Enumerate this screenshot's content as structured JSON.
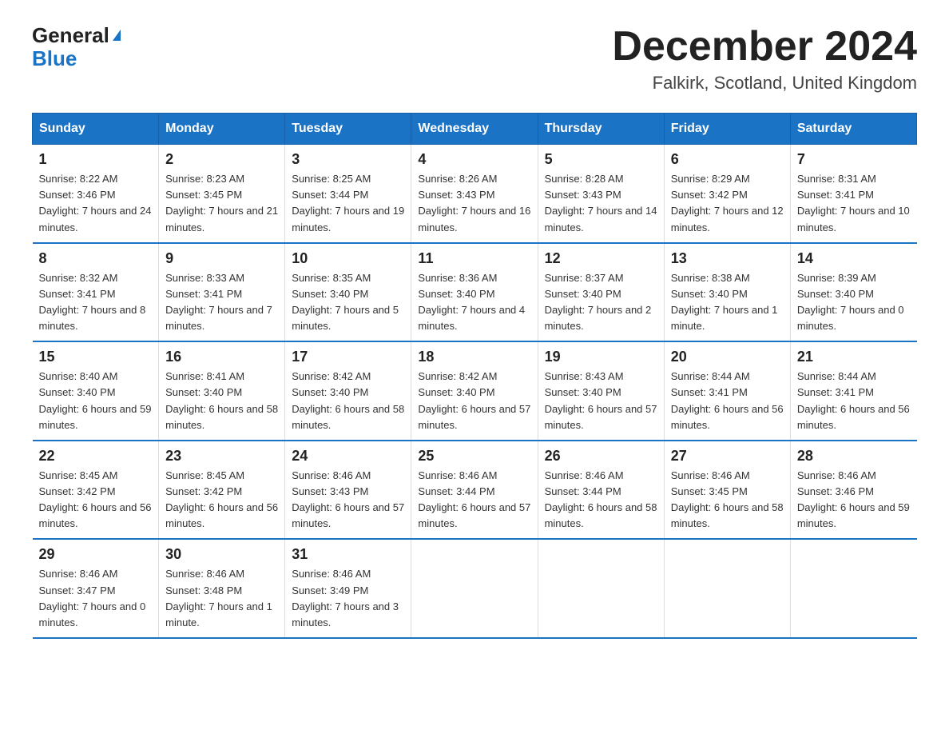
{
  "header": {
    "logo_general": "General",
    "logo_blue": "Blue",
    "title": "December 2024",
    "subtitle": "Falkirk, Scotland, United Kingdom"
  },
  "days_of_week": [
    "Sunday",
    "Monday",
    "Tuesday",
    "Wednesday",
    "Thursday",
    "Friday",
    "Saturday"
  ],
  "weeks": [
    [
      {
        "num": "1",
        "sunrise": "8:22 AM",
        "sunset": "3:46 PM",
        "daylight": "7 hours and 24 minutes."
      },
      {
        "num": "2",
        "sunrise": "8:23 AM",
        "sunset": "3:45 PM",
        "daylight": "7 hours and 21 minutes."
      },
      {
        "num": "3",
        "sunrise": "8:25 AM",
        "sunset": "3:44 PM",
        "daylight": "7 hours and 19 minutes."
      },
      {
        "num": "4",
        "sunrise": "8:26 AM",
        "sunset": "3:43 PM",
        "daylight": "7 hours and 16 minutes."
      },
      {
        "num": "5",
        "sunrise": "8:28 AM",
        "sunset": "3:43 PM",
        "daylight": "7 hours and 14 minutes."
      },
      {
        "num": "6",
        "sunrise": "8:29 AM",
        "sunset": "3:42 PM",
        "daylight": "7 hours and 12 minutes."
      },
      {
        "num": "7",
        "sunrise": "8:31 AM",
        "sunset": "3:41 PM",
        "daylight": "7 hours and 10 minutes."
      }
    ],
    [
      {
        "num": "8",
        "sunrise": "8:32 AM",
        "sunset": "3:41 PM",
        "daylight": "7 hours and 8 minutes."
      },
      {
        "num": "9",
        "sunrise": "8:33 AM",
        "sunset": "3:41 PM",
        "daylight": "7 hours and 7 minutes."
      },
      {
        "num": "10",
        "sunrise": "8:35 AM",
        "sunset": "3:40 PM",
        "daylight": "7 hours and 5 minutes."
      },
      {
        "num": "11",
        "sunrise": "8:36 AM",
        "sunset": "3:40 PM",
        "daylight": "7 hours and 4 minutes."
      },
      {
        "num": "12",
        "sunrise": "8:37 AM",
        "sunset": "3:40 PM",
        "daylight": "7 hours and 2 minutes."
      },
      {
        "num": "13",
        "sunrise": "8:38 AM",
        "sunset": "3:40 PM",
        "daylight": "7 hours and 1 minute."
      },
      {
        "num": "14",
        "sunrise": "8:39 AM",
        "sunset": "3:40 PM",
        "daylight": "7 hours and 0 minutes."
      }
    ],
    [
      {
        "num": "15",
        "sunrise": "8:40 AM",
        "sunset": "3:40 PM",
        "daylight": "6 hours and 59 minutes."
      },
      {
        "num": "16",
        "sunrise": "8:41 AM",
        "sunset": "3:40 PM",
        "daylight": "6 hours and 58 minutes."
      },
      {
        "num": "17",
        "sunrise": "8:42 AM",
        "sunset": "3:40 PM",
        "daylight": "6 hours and 58 minutes."
      },
      {
        "num": "18",
        "sunrise": "8:42 AM",
        "sunset": "3:40 PM",
        "daylight": "6 hours and 57 minutes."
      },
      {
        "num": "19",
        "sunrise": "8:43 AM",
        "sunset": "3:40 PM",
        "daylight": "6 hours and 57 minutes."
      },
      {
        "num": "20",
        "sunrise": "8:44 AM",
        "sunset": "3:41 PM",
        "daylight": "6 hours and 56 minutes."
      },
      {
        "num": "21",
        "sunrise": "8:44 AM",
        "sunset": "3:41 PM",
        "daylight": "6 hours and 56 minutes."
      }
    ],
    [
      {
        "num": "22",
        "sunrise": "8:45 AM",
        "sunset": "3:42 PM",
        "daylight": "6 hours and 56 minutes."
      },
      {
        "num": "23",
        "sunrise": "8:45 AM",
        "sunset": "3:42 PM",
        "daylight": "6 hours and 56 minutes."
      },
      {
        "num": "24",
        "sunrise": "8:46 AM",
        "sunset": "3:43 PM",
        "daylight": "6 hours and 57 minutes."
      },
      {
        "num": "25",
        "sunrise": "8:46 AM",
        "sunset": "3:44 PM",
        "daylight": "6 hours and 57 minutes."
      },
      {
        "num": "26",
        "sunrise": "8:46 AM",
        "sunset": "3:44 PM",
        "daylight": "6 hours and 58 minutes."
      },
      {
        "num": "27",
        "sunrise": "8:46 AM",
        "sunset": "3:45 PM",
        "daylight": "6 hours and 58 minutes."
      },
      {
        "num": "28",
        "sunrise": "8:46 AM",
        "sunset": "3:46 PM",
        "daylight": "6 hours and 59 minutes."
      }
    ],
    [
      {
        "num": "29",
        "sunrise": "8:46 AM",
        "sunset": "3:47 PM",
        "daylight": "7 hours and 0 minutes."
      },
      {
        "num": "30",
        "sunrise": "8:46 AM",
        "sunset": "3:48 PM",
        "daylight": "7 hours and 1 minute."
      },
      {
        "num": "31",
        "sunrise": "8:46 AM",
        "sunset": "3:49 PM",
        "daylight": "7 hours and 3 minutes."
      },
      null,
      null,
      null,
      null
    ]
  ]
}
